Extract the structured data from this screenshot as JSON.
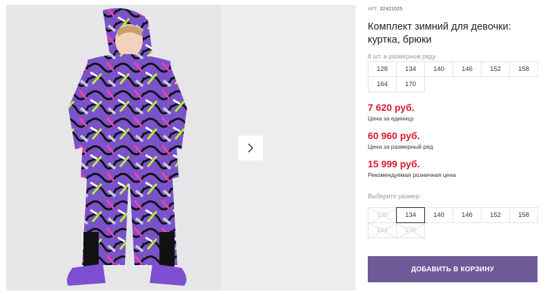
{
  "gallery": {
    "main_photo_alt": "",
    "colors": {
      "suit_purple": "#6b46b8",
      "boots": "#7c4fd0",
      "background": "#e6e6e8"
    }
  },
  "product": {
    "article_label": "АРТ.",
    "article_value": "32421025",
    "title": "Комплект зимний для девочки: куртка, брюки",
    "pack_note": "8 шт. в размерном ряду",
    "pack_sizes": [
      "128",
      "134",
      "140",
      "146",
      "152",
      "158",
      "164",
      "170"
    ]
  },
  "prices": [
    {
      "value": "7 620 руб.",
      "label": "Цена за единицу"
    },
    {
      "value": "60 960 руб.",
      "label": "Цена за размерный ряд"
    },
    {
      "value": "15 999 руб.",
      "label": "Рекомендуемая розничная цена"
    }
  ],
  "size_selector": {
    "label": "Выберите размер:",
    "sizes": [
      {
        "value": "128",
        "state": "disabled"
      },
      {
        "value": "134",
        "state": "selected"
      },
      {
        "value": "140",
        "state": "available"
      },
      {
        "value": "146",
        "state": "available"
      },
      {
        "value": "152",
        "state": "available"
      },
      {
        "value": "158",
        "state": "available"
      },
      {
        "value": "164",
        "state": "disabled"
      },
      {
        "value": "170",
        "state": "disabled"
      }
    ]
  },
  "cart": {
    "add_label": "ДОБАВИТЬ В КОРЗИНУ",
    "button_color": "#6d5a97"
  },
  "accent_price_color": "#d81a2a",
  "icons": {
    "next": "chevron-right-icon"
  }
}
